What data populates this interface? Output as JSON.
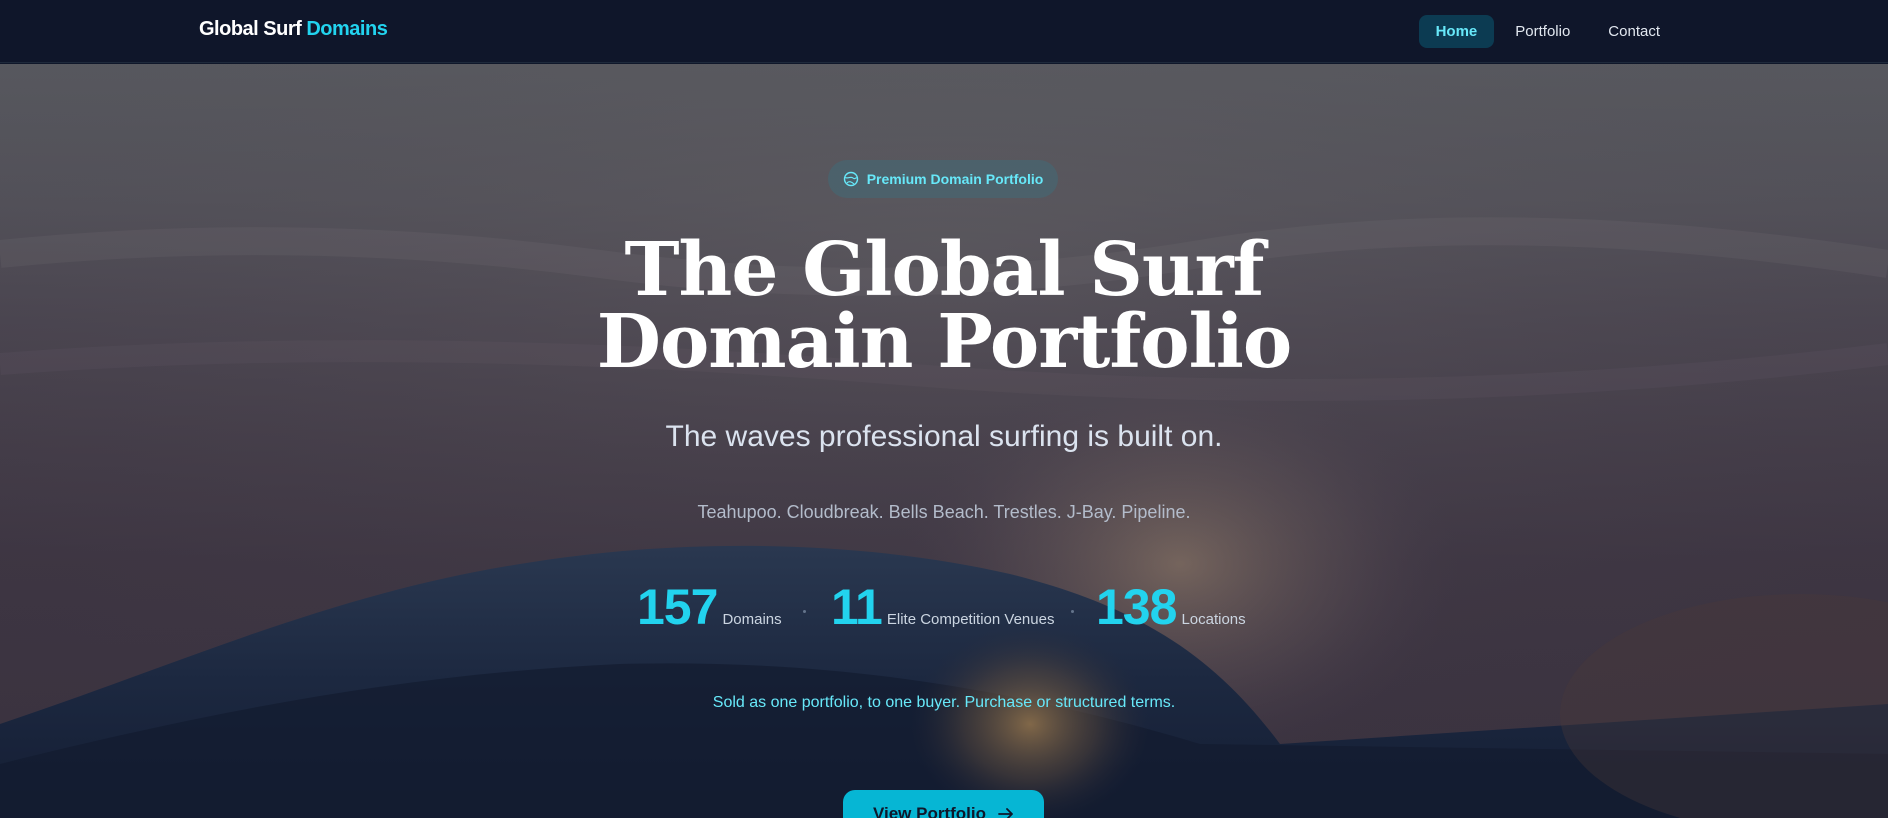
{
  "nav": {
    "brand_main": "Global Surf",
    "brand_accent": "Domains",
    "links": [
      {
        "label": "Home",
        "active": true
      },
      {
        "label": "Portfolio",
        "active": false
      },
      {
        "label": "Contact",
        "active": false
      }
    ]
  },
  "hero": {
    "badge": "Premium Domain Portfolio",
    "badge_icon": "globe-icon",
    "title_line1": "The Global Surf",
    "title_line2": "Domain Portfolio",
    "subtitle": "The waves professional surfing is built on.",
    "venues": "Teahupoo. Cloudbreak. Bells Beach. Trestles. J-Bay. Pipeline.",
    "stats": [
      {
        "value": "157",
        "label": "Domains"
      },
      {
        "value": "11",
        "label": "Elite Competition Venues"
      },
      {
        "value": "138",
        "label": "Locations"
      }
    ],
    "terms": "Sold as one portfolio, to one buyer. Purchase or structured terms.",
    "cta_label": "View Portfolio",
    "cta_icon": "arrow-right-icon"
  },
  "colors": {
    "accent": "#22d3ee",
    "navbar_bg": "#0f162a",
    "cta_bg": "#06b6d4"
  }
}
